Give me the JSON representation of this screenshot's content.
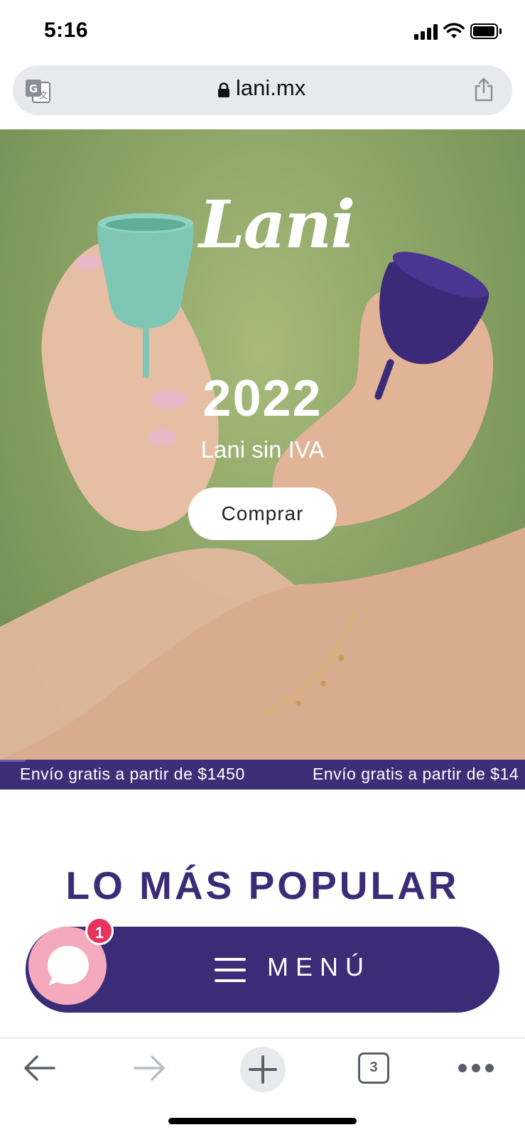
{
  "status_bar": {
    "time": "5:16"
  },
  "browser": {
    "url": "lani.mx",
    "icons": [
      "translate-icon",
      "lock-icon",
      "share-icon"
    ]
  },
  "hero": {
    "brand": "Lani",
    "year": "2022",
    "subtitle": "Lani sin IVA",
    "cta_label": "Comprar"
  },
  "promo": {
    "text_1": "Envío gratis a partir de $1450",
    "text_2": "Envío gratis a partir de $14"
  },
  "section": {
    "title": "LO MÁS POPULAR"
  },
  "menu": {
    "label": "MENÚ"
  },
  "chat": {
    "badge_count": "1"
  },
  "toolbar": {
    "tab_count": "3"
  },
  "colors": {
    "brand_purple": "#3b2c77",
    "chat_pink": "#f4a9bd",
    "badge_red": "#e8335c",
    "hero_green": "#8ba466"
  }
}
